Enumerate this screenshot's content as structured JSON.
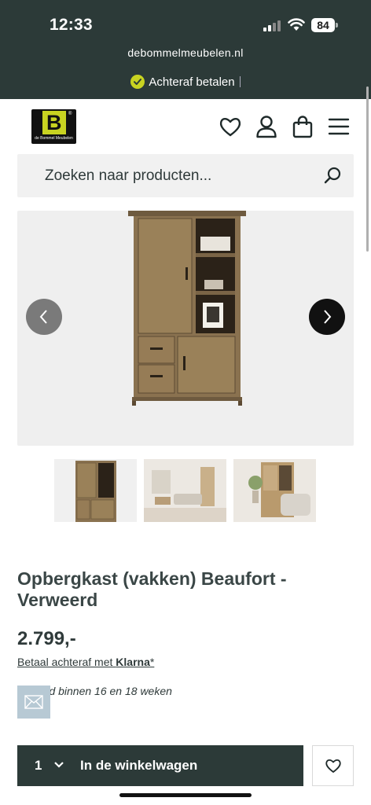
{
  "status_bar": {
    "time": "12:33",
    "battery": "84"
  },
  "browser": {
    "domain": "debommelmeubelen.nl"
  },
  "usp": {
    "text": "Achteraf betalen"
  },
  "header": {
    "logo_letters": "de B",
    "logo_tagline": "de Bommel Meubelen",
    "icons": [
      "heart-icon",
      "user-icon",
      "bag-icon",
      "menu-icon"
    ]
  },
  "search": {
    "placeholder": "Zoeken naar producten..."
  },
  "gallery": {
    "thumbnail_count": 3
  },
  "product": {
    "title": "Opbergkast (vakken) Beaufort - Verweerd",
    "price": "2.799,-",
    "klarna_prefix": "Betaal achteraf met ",
    "klarna_brand": "Klarna",
    "klarna_suffix": "*",
    "delivery": "erd binnen 16 en 18 weken"
  },
  "cart": {
    "quantity": "1",
    "label": "In de winkelwagen"
  },
  "colors": {
    "brand_dark": "#2c3a38",
    "brand_lime": "#c8d321",
    "gallery_bg": "#efefef"
  }
}
